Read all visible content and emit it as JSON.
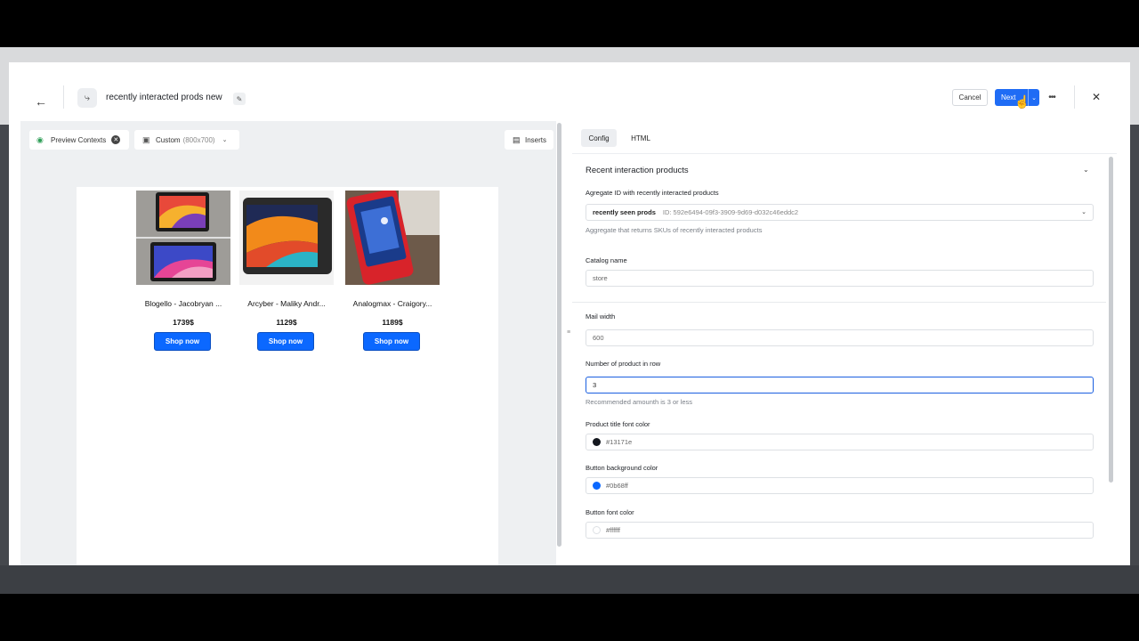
{
  "header": {
    "title": "recently interacted prods new",
    "cancel_label": "Cancel",
    "next_label": "Next"
  },
  "preview": {
    "contexts_label": "Preview Contexts",
    "size_label": "Custom",
    "size_dim": "(800x700)",
    "inserts_label": "Inserts",
    "products": [
      {
        "name": "Blogello - Jacobryan ...",
        "price": "1739$",
        "button": "Shop now"
      },
      {
        "name": "Arcyber - Maliky Andr...",
        "price": "1129$",
        "button": "Shop now"
      },
      {
        "name": "Analogmax - Craigory...",
        "price": "1189$",
        "button": "Shop now"
      }
    ]
  },
  "config": {
    "tabs": [
      "Config",
      "HTML"
    ],
    "section_title": "Recent interaction products",
    "aggregate": {
      "label": "Agregate ID with recently interacted products",
      "name": "recently seen prods",
      "id": "ID: 592e6494-09f3-3909-9d69-d032c46eddc2",
      "helper": "Aggregate that returns SKUs of recently interacted products"
    },
    "catalog": {
      "label": "Catalog name",
      "value": "store"
    },
    "mail_width": {
      "label": "Mail width",
      "value": "600"
    },
    "products_in_row": {
      "label": "Number of product in row",
      "value": "3",
      "helper": "Recommended amounth is 3 or less"
    },
    "title_color": {
      "label": "Product title font color",
      "value": "#13171e",
      "swatch": "#13171e"
    },
    "button_bg": {
      "label": "Button background color",
      "value": "#0b68ff",
      "swatch": "#0b68ff"
    },
    "button_font": {
      "label": "Button font color",
      "value": "#ffffff",
      "swatch": "#ffffff"
    }
  }
}
